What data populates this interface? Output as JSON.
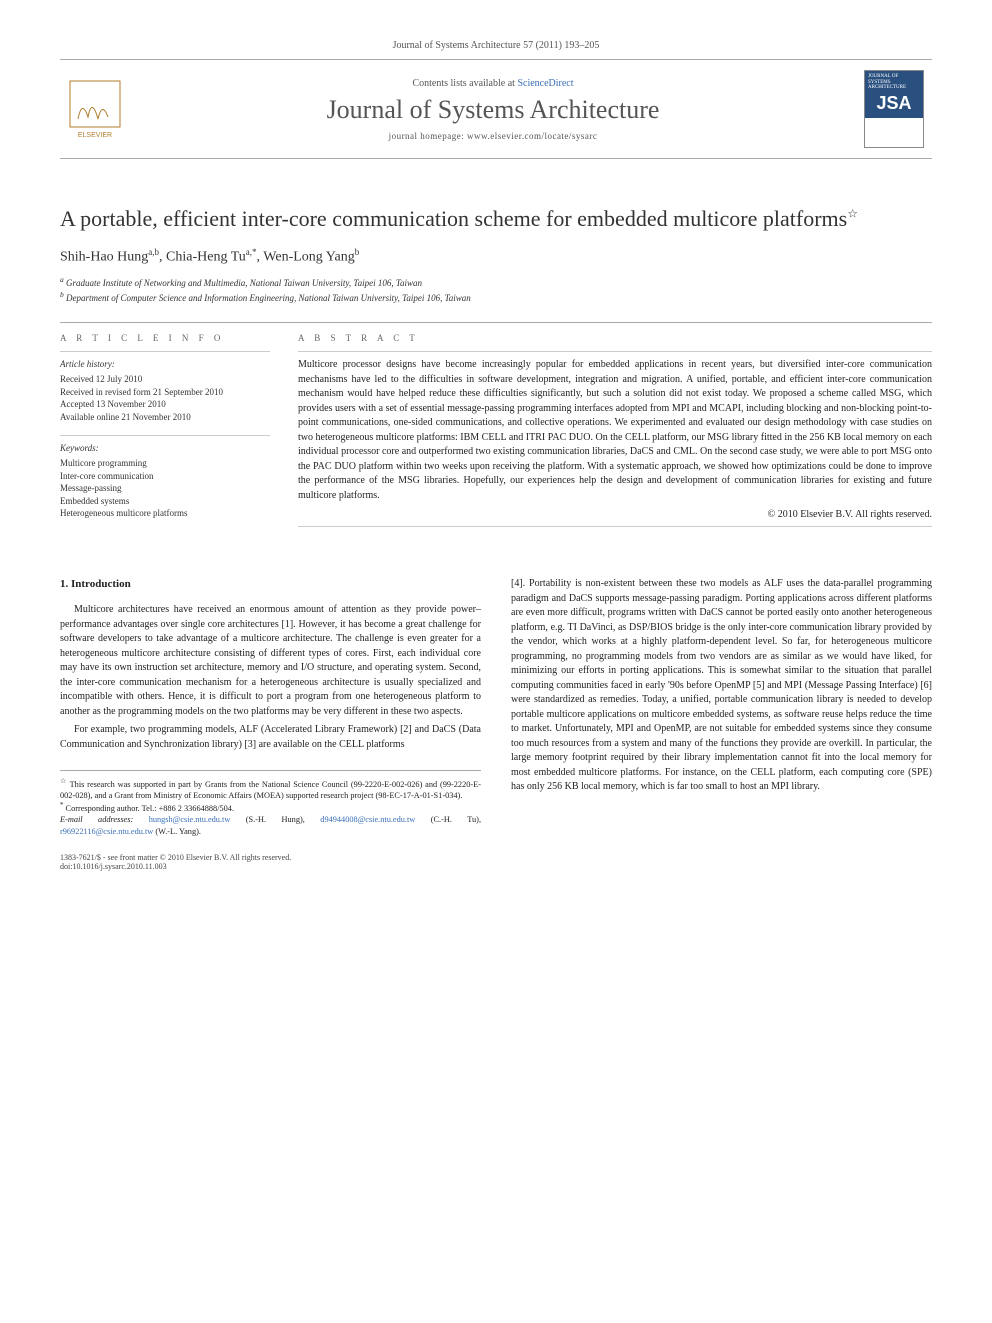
{
  "citation": "Journal of Systems Architecture 57 (2011) 193–205",
  "header": {
    "contents_prefix": "Contents lists available at ",
    "sciencedirect": "ScienceDirect",
    "journal": "Journal of Systems Architecture",
    "homepage_prefix": "journal homepage: ",
    "homepage": "www.elsevier.com/locate/sysarc",
    "publisher": "ELSEVIER",
    "cover_small": "JOURNAL OF SYSTEMS ARCHITECTURE",
    "cover_big": "JSA"
  },
  "title": "A portable, efficient inter-core communication scheme for embedded multicore platforms",
  "title_mark": "☆",
  "authors_html": "Shih-Hao Hung",
  "authors": [
    {
      "name": "Shih-Hao Hung",
      "marks": "a,b"
    },
    {
      "name": "Chia-Heng Tu",
      "marks": "a,*"
    },
    {
      "name": "Wen-Long Yang",
      "marks": "b"
    }
  ],
  "affiliations": [
    {
      "mark": "a",
      "text": "Graduate Institute of Networking and Multimedia, National Taiwan University, Taipei 106, Taiwan"
    },
    {
      "mark": "b",
      "text": "Department of Computer Science and Information Engineering, National Taiwan University, Taipei 106, Taiwan"
    }
  ],
  "article_info": {
    "head": "A R T I C L E   I N F O",
    "history_head": "Article history:",
    "history": [
      "Received 12 July 2010",
      "Received in revised form 21 September 2010",
      "Accepted 13 November 2010",
      "Available online 21 November 2010"
    ],
    "keywords_head": "Keywords:",
    "keywords": [
      "Multicore programming",
      "Inter-core communication",
      "Message-passing",
      "Embedded systems",
      "Heterogeneous multicore platforms"
    ]
  },
  "abstract": {
    "head": "A B S T R A C T",
    "text": "Multicore processor designs have become increasingly popular for embedded applications in recent years, but diversified inter-core communication mechanisms have led to the difficulties in software development, integration and migration. A unified, portable, and efficient inter-core communication mechanism would have helped reduce these difficulties significantly, but such a solution did not exist today. We proposed a scheme called MSG, which provides users with a set of essential message-passing programming interfaces adopted from MPI and MCAPI, including blocking and non-blocking point-to-point communications, one-sided communications, and collective operations. We experimented and evaluated our design methodology with case studies on two heterogeneous multicore platforms: IBM CELL and ITRI PAC DUO. On the CELL platform, our MSG library fitted in the 256 KB local memory on each individual processor core and outperformed two existing communication libraries, DaCS and CML. On the second case study, we were able to port MSG onto the PAC DUO platform within two weeks upon receiving the platform. With a systematic approach, we showed how optimizations could be done to improve the performance of the MSG libraries. Hopefully, our experiences help the design and development of communication libraries for existing and future multicore platforms.",
    "copyright": "© 2010 Elsevier B.V. All rights reserved."
  },
  "body": {
    "section_head": "1. Introduction",
    "col1_p1": "Multicore architectures have received an enormous amount of attention as they provide power–performance advantages over single core architectures [1]. However, it has become a great challenge for software developers to take advantage of a multicore architecture. The challenge is even greater for a heterogeneous multicore architecture consisting of different types of cores. First, each individual core may have its own instruction set architecture, memory and I/O structure, and operating system. Second, the inter-core communication mechanism for a heterogeneous architecture is usually specialized and incompatible with others. Hence, it is difficult to port a program from one heterogeneous platform to another as the programming models on the two platforms may be very different in these two aspects.",
    "col1_p2": "For example, two programming models, ALF (Accelerated Library Framework) [2] and DaCS (Data Communication and Synchronization library) [3] are available on the CELL platforms",
    "col2_p1": "[4]. Portability is non-existent between these two models as ALF uses the data-parallel programming paradigm and DaCS supports message-passing paradigm. Porting applications across different platforms are even more difficult, programs written with DaCS cannot be ported easily onto another heterogeneous platform, e.g. TI DaVinci, as DSP/BIOS bridge is the only inter-core communication library provided by the vendor, which works at a highly platform-dependent level. So far, for heterogeneous multicore programming, no programming models from two vendors are as similar as we would have liked, for minimizing our efforts in porting applications. This is somewhat similar to the situation that parallel computing communities faced in early '90s before OpenMP [5] and MPI (Message Passing Interface) [6] were standardized as remedies. Today, a unified, portable communication library is needed to develop portable multicore applications on multicore embedded systems, as software reuse helps reduce the time to market. Unfortunately, MPI and OpenMP, are not suitable for embedded systems since they consume too much resources from a system and many of the functions they provide are overkill. In particular, the large memory footprint required by their library implementation cannot fit into the local memory for most embedded multicore platforms. For instance, on the CELL platform, each computing core (SPE) has only 256 KB local memory, which is far too small to host an MPI library."
  },
  "footnotes": {
    "funding_mark": "☆",
    "funding": "This research was supported in part by Grants from the National Science Council (99-2220-E-002-026) and (99-2220-E-002-028), and a Grant from Ministry of Economic Affairs (MOEA) supported research project (98-EC-17-A-01-S1-034).",
    "corresponding_mark": "*",
    "corresponding": "Corresponding author. Tel.: +886 2 33664888/504.",
    "email_label": "E-mail addresses:",
    "emails": [
      {
        "addr": "hungsh@csie.ntu.edu.tw",
        "who": "(S.-H. Hung)"
      },
      {
        "addr": "d94944008@csie.ntu.edu.tw",
        "who": "(C.-H. Tu)"
      },
      {
        "addr": "r96922116@csie.ntu.edu.tw",
        "who": "(W.-L. Yang)"
      }
    ]
  },
  "footer": {
    "issn": "1383-7621/$ - see front matter © 2010 Elsevier B.V. All rights reserved.",
    "doi": "doi:10.1016/j.sysarc.2010.11.003"
  }
}
